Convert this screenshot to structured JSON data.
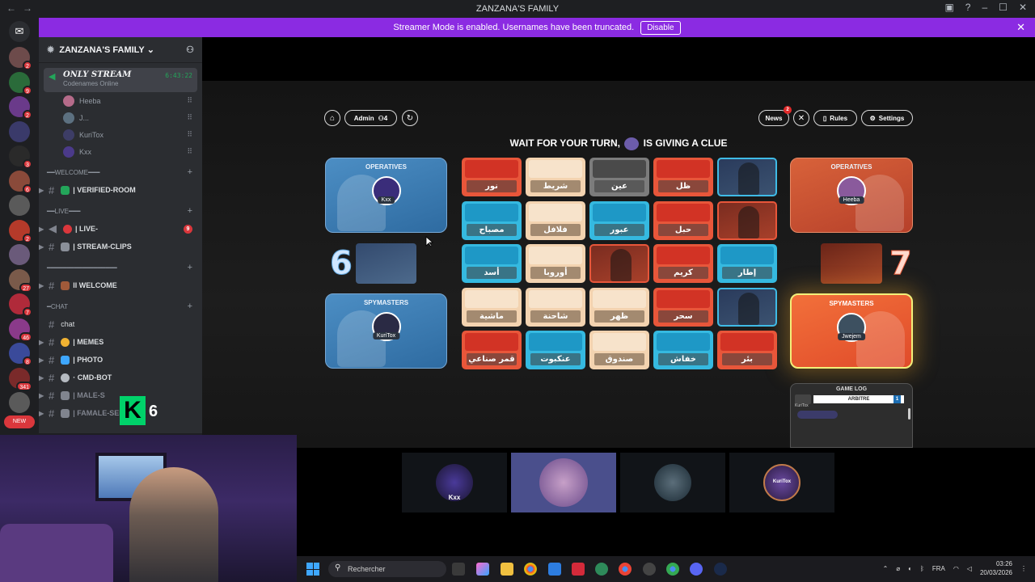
{
  "window": {
    "title": "ZANZANA'S FAMILY",
    "back": "←",
    "forward": "→"
  },
  "banner": {
    "text": "Streamer Mode is enabled. Usernames have been truncated.",
    "button": "Disable"
  },
  "servers": [
    {
      "badge": "2"
    },
    {
      "badge": "9"
    },
    {
      "badge": "2"
    },
    {
      "badge": ""
    },
    {
      "badge": "3"
    },
    {
      "badge": "6"
    },
    {
      "badge": ""
    },
    {
      "badge": "2"
    },
    {
      "badge": ""
    },
    {
      "badge": "27"
    },
    {
      "badge": "7"
    },
    {
      "badge": "46"
    },
    {
      "badge": "8"
    },
    {
      "badge": "341"
    },
    {
      "badge": ""
    }
  ],
  "servers_new": "NEW",
  "sidebar": {
    "guild_name": "ZANZANA'S FAMILY",
    "voice": {
      "name": "ONLY STREAM",
      "status": "Codenames Online",
      "time": "6:43:22"
    },
    "members": [
      "Heeba",
      "J...",
      "KuriTox",
      "Kxx"
    ],
    "cat_welcome": "━━WELCOME━━━",
    "verified": "| VERIFIED-ROOM",
    "cat_live": "━━LIVE━━━",
    "live": "| LIVE-",
    "live_count": "9",
    "stream_clips": "| STREAM-CLIPS",
    "cat_sep": "━━━━━━━━━━━━━━━━━━",
    "welcome": "ll WELCOME",
    "cat_chat": "━CHAT",
    "chat": "chat",
    "memes": "| MEMES",
    "photo": "| PHOTO",
    "cmdbot": "· CMD-BOT",
    "males": "| MALE-S",
    "females": "| FAMALE-SELFIES"
  },
  "game": {
    "admin": "Admin",
    "players_count": "4",
    "news": "News",
    "news_badge": "2",
    "rules": "Rules",
    "settings": "Settings",
    "headline_a": "WAIT FOR YOUR TURN,",
    "headline_b": "IS GIVING A CLUE",
    "blue_operatives": {
      "title": "OPERATIVES",
      "player": "Kxx"
    },
    "blue_spymasters": {
      "title": "SPYMASTERS",
      "player": "KuriTox"
    },
    "red_operatives": {
      "title": "OPERATIVES",
      "player": "Heeba"
    },
    "red_spymasters": {
      "title": "SPYMASTERS",
      "player": "Jwejem"
    },
    "blue_remaining": "6",
    "red_remaining": "7",
    "cards": [
      {
        "word": "نور",
        "color": "red"
      },
      {
        "word": "شريط",
        "color": "beige"
      },
      {
        "word": "عين",
        "color": "grey"
      },
      {
        "word": "ظل",
        "color": "red"
      },
      {
        "word": "",
        "color": "flipblue"
      },
      {
        "word": "مصباح",
        "color": "blue"
      },
      {
        "word": "فلافل",
        "color": "beige"
      },
      {
        "word": "عبور",
        "color": "blue"
      },
      {
        "word": "حبل",
        "color": "red"
      },
      {
        "word": "",
        "color": "flipred"
      },
      {
        "word": "أسد",
        "color": "blue"
      },
      {
        "word": "أوروبا",
        "color": "beige"
      },
      {
        "word": "",
        "color": "flipred"
      },
      {
        "word": "كريم",
        "color": "red"
      },
      {
        "word": "إطار",
        "color": "blue"
      },
      {
        "word": "ماشية",
        "color": "beige"
      },
      {
        "word": "شاحنة",
        "color": "beige"
      },
      {
        "word": "ظهر",
        "color": "beige"
      },
      {
        "word": "سحر",
        "color": "red"
      },
      {
        "word": "",
        "color": "flipblue"
      },
      {
        "word": "قمر صناعي",
        "color": "red"
      },
      {
        "word": "عنكبوت",
        "color": "blue"
      },
      {
        "word": "صندوق",
        "color": "beige"
      },
      {
        "word": "خفاش",
        "color": "blue"
      },
      {
        "word": "بئر",
        "color": "red"
      }
    ],
    "gamelog": {
      "title": "GAME LOG",
      "entry": "ARBITRE",
      "entry_num": "1",
      "entry_user": "KuriTox"
    }
  },
  "stream_tiles": [
    "Kxx",
    "",
    "",
    "KuriTox"
  ],
  "overlay": {
    "k_letter": "K",
    "k_number": "6"
  },
  "taskbar": {
    "search_placeholder": "Rechercher",
    "lang": "FRA",
    "time": "03:26",
    "date": "20/03/2026"
  },
  "colors": {
    "banner": "#8b2be2",
    "blue_team": "#35b9e0",
    "red_team": "#e8563a",
    "neutral": "#f3d3b0",
    "assassin": "#7c7c7c"
  }
}
